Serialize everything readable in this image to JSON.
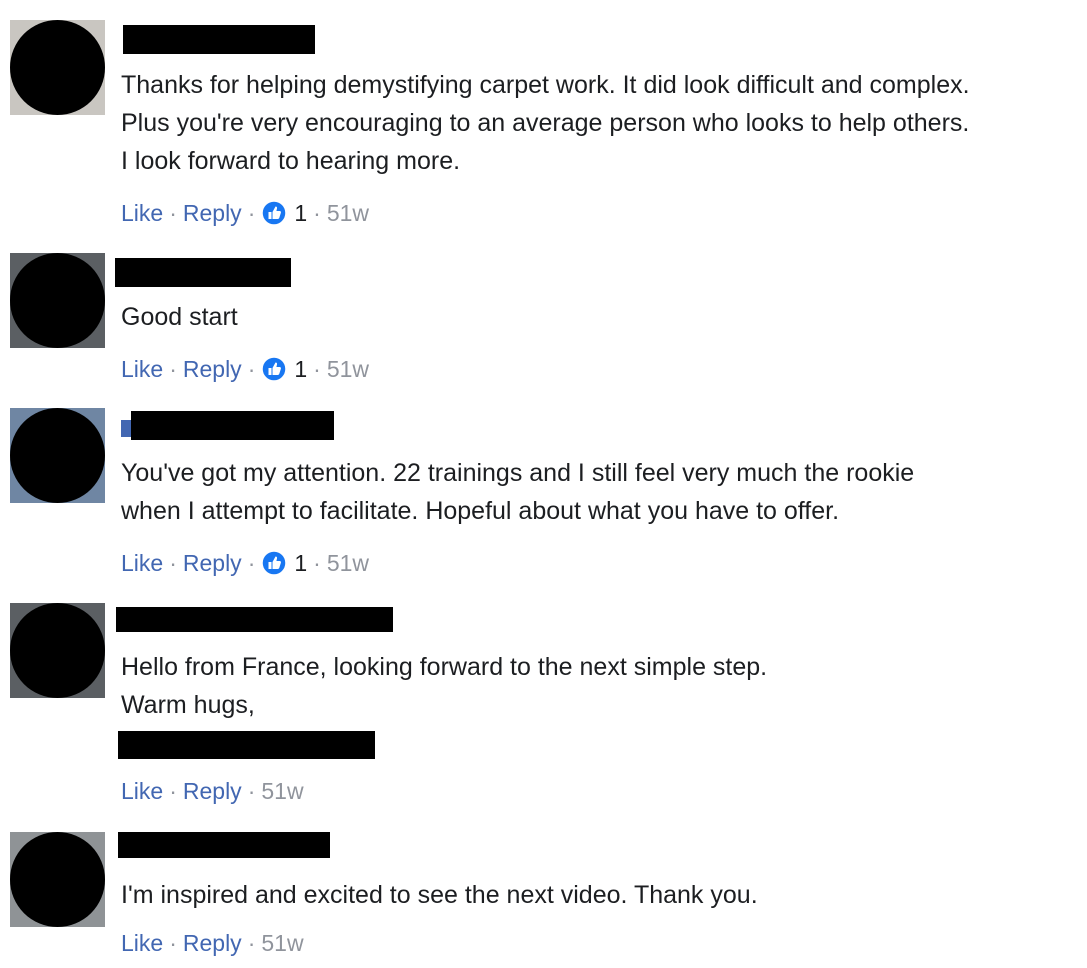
{
  "actions": {
    "like_label": "Like",
    "reply_label": "Reply",
    "separator": "·"
  },
  "colors": {
    "link": "#4267b2",
    "muted": "#90949c",
    "text": "#1c1e21",
    "like_icon": "#1877f2"
  },
  "comments": [
    {
      "text": "Thanks for helping demystifying carpet work. It did look difficult and complex.\nPlus you're very encouraging to an average person who looks to help others.\nI look forward to hearing more.",
      "reaction_icon": "thumbs-up-icon",
      "reaction_count": "1",
      "time": "51w"
    },
    {
      "text": "Good start",
      "reaction_icon": "thumbs-up-icon",
      "reaction_count": "1",
      "time": "51w"
    },
    {
      "text": "You've got my attention. 22 trainings and I still feel very much the rookie\nwhen I attempt to facilitate. Hopeful about what you have to offer.",
      "reaction_icon": "thumbs-up-icon",
      "reaction_count": "1",
      "time": "51w"
    },
    {
      "text": "Hello from France, looking forward to the next simple step.\nWarm hugs,",
      "time": "51w"
    },
    {
      "text": "I'm inspired and excited to see the next video. Thank you.",
      "time": "51w"
    }
  ]
}
